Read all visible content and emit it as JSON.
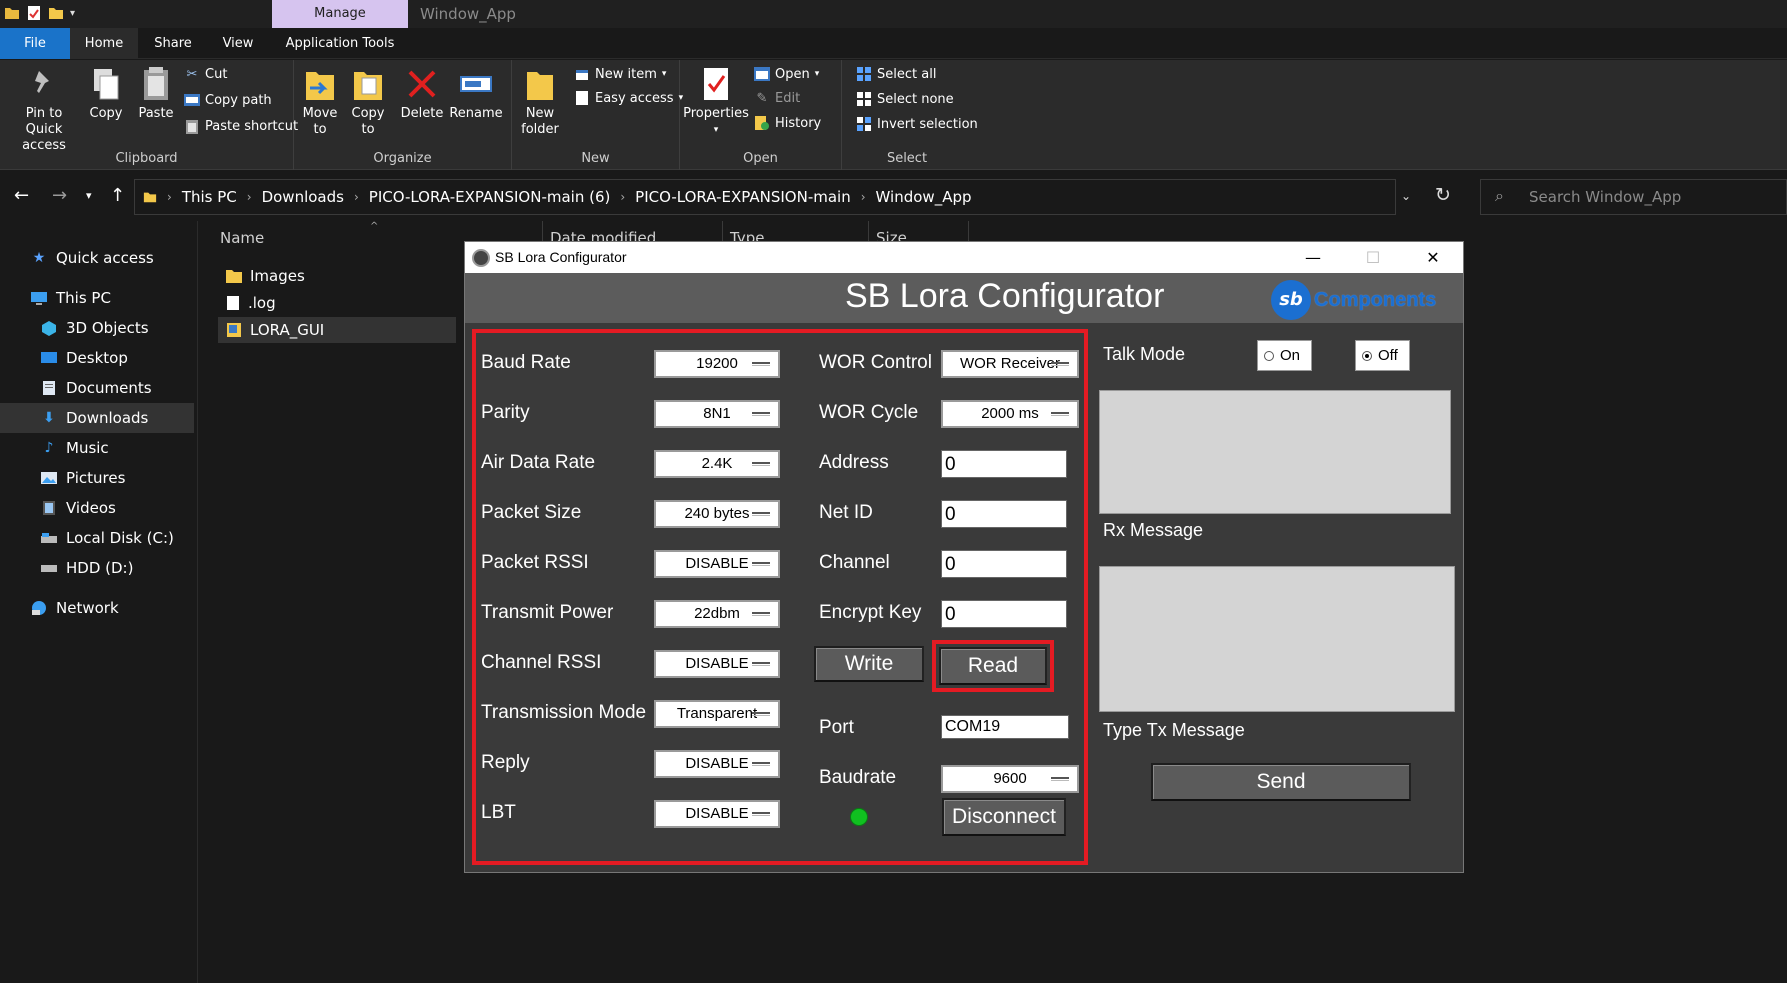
{
  "explorer": {
    "window_title": "Window_App",
    "manage_tab": "Manage",
    "ribbon_tabs": [
      "File",
      "Home",
      "Share",
      "View",
      "Application Tools"
    ],
    "groups": {
      "clipboard": {
        "label": "Clipboard",
        "pin": "Pin to Quick access",
        "copy": "Copy",
        "paste": "Paste",
        "cut": "Cut",
        "copy_path": "Copy path",
        "paste_shortcut": "Paste shortcut"
      },
      "organize": {
        "label": "Organize",
        "move_to": "Move to",
        "copy_to": "Copy to",
        "delete": "Delete",
        "rename": "Rename"
      },
      "new": {
        "label": "New",
        "new_folder": "New folder",
        "new_item": "New item",
        "easy_access": "Easy access"
      },
      "open": {
        "label": "Open",
        "properties": "Properties",
        "open": "Open",
        "edit": "Edit",
        "history": "History"
      },
      "select": {
        "label": "Select",
        "select_all": "Select all",
        "select_none": "Select none",
        "invert": "Invert selection"
      }
    },
    "breadcrumbs": [
      "This PC",
      "Downloads",
      "PICO-LORA-EXPANSION-main (6)",
      "PICO-LORA-EXPANSION-main",
      "Window_App"
    ],
    "search_placeholder": "Search Window_App",
    "nav": {
      "quick_access": "Quick access",
      "this_pc": "This PC",
      "objects_3d": "3D Objects",
      "desktop": "Desktop",
      "documents": "Documents",
      "downloads": "Downloads",
      "music": "Music",
      "pictures": "Pictures",
      "videos": "Videos",
      "local_disk": "Local Disk (C:)",
      "hdd": "HDD (D:)",
      "network": "Network"
    },
    "columns": {
      "name": "Name",
      "date_modified": "Date modified",
      "type": "Type",
      "size": "Size"
    },
    "files": [
      "Images",
      ".log",
      "LORA_GUI"
    ]
  },
  "configurator": {
    "window_title": "SB Lora Configurator",
    "heading": "SB Lora Configurator",
    "logo_text": "Components",
    "logo_mark": "sb",
    "fields_left": [
      {
        "label": "Baud Rate",
        "value": "19200"
      },
      {
        "label": "Parity",
        "value": "8N1"
      },
      {
        "label": "Air Data Rate",
        "value": "2.4K"
      },
      {
        "label": "Packet Size",
        "value": "240 bytes"
      },
      {
        "label": "Packet RSSI",
        "value": "DISABLE"
      },
      {
        "label": "Transmit Power",
        "value": "22dbm"
      },
      {
        "label": "Channel RSSI",
        "value": "DISABLE"
      },
      {
        "label": "Transmission Mode",
        "value": "Transparent"
      },
      {
        "label": "Reply",
        "value": "DISABLE"
      },
      {
        "label": "LBT",
        "value": "DISABLE"
      }
    ],
    "wor_control": {
      "label": "WOR Control",
      "value": "WOR Receiver"
    },
    "wor_cycle": {
      "label": "WOR Cycle",
      "value": "2000 ms"
    },
    "address": {
      "label": "Address",
      "value": "0"
    },
    "net_id": {
      "label": "Net ID",
      "value": "0"
    },
    "channel": {
      "label": "Channel",
      "value": "0"
    },
    "encrypt_key": {
      "label": "Encrypt Key",
      "value": "0"
    },
    "write_button": "Write",
    "read_button": "Read",
    "port": {
      "label": "Port",
      "value": "COM19"
    },
    "baudrate": {
      "label": "Baudrate",
      "value": "9600"
    },
    "disconnect_button": "Disconnect",
    "talk_mode": {
      "label": "Talk Mode",
      "on": "On",
      "off": "Off",
      "selected": "Off"
    },
    "rx_label": "Rx Message",
    "tx_label": "Type Tx Message",
    "send_button": "Send",
    "colors": {
      "highlight": "#e41b23",
      "connected": "#10c020"
    }
  }
}
